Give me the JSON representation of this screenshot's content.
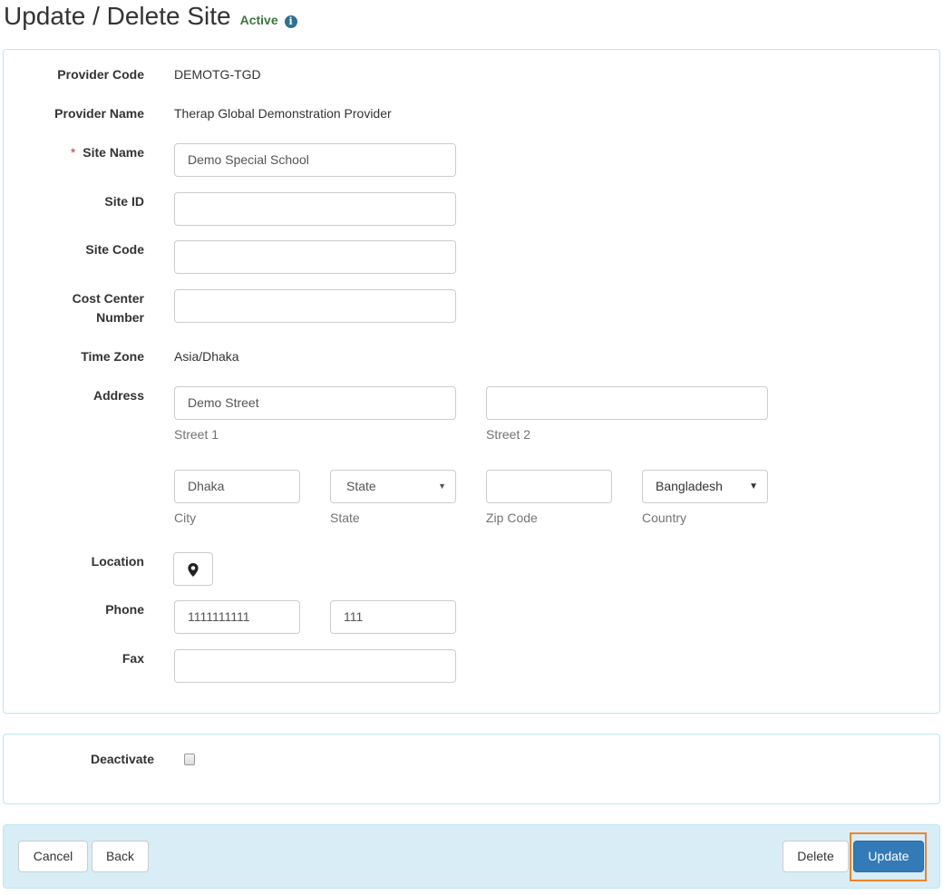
{
  "header": {
    "title": "Update / Delete Site",
    "status": "Active",
    "info_icon": "info-circle-icon"
  },
  "form": {
    "provider_code": {
      "label": "Provider Code",
      "value": "DEMOTG-TGD"
    },
    "provider_name": {
      "label": "Provider Name",
      "value": "Therap Global Demonstration Provider"
    },
    "site_name": {
      "label": "Site Name",
      "required_mark": "*",
      "value": "Demo Special School"
    },
    "site_id": {
      "label": "Site ID",
      "value": ""
    },
    "site_code": {
      "label": "Site Code",
      "value": ""
    },
    "cost_center": {
      "label_line1": "Cost Center",
      "label_line2": "Number",
      "value": ""
    },
    "time_zone": {
      "label": "Time Zone",
      "value": "Asia/Dhaka"
    },
    "address": {
      "label": "Address",
      "street1": {
        "value": "Demo Street",
        "help": "Street 1"
      },
      "street2": {
        "value": "",
        "help": "Street 2"
      },
      "city": {
        "value": "Dhaka",
        "help": "City"
      },
      "state": {
        "value": "State",
        "help": "State"
      },
      "zip": {
        "value": "",
        "help": "Zip Code"
      },
      "country": {
        "value": "Bangladesh",
        "help": "Country"
      }
    },
    "location": {
      "label": "Location",
      "icon": "map-marker-icon"
    },
    "phone": {
      "label": "Phone",
      "number": "1111111111",
      "ext": "111"
    },
    "fax": {
      "label": "Fax",
      "value": ""
    }
  },
  "deactivate": {
    "label": "Deactivate",
    "checked": false
  },
  "actions": {
    "cancel": "Cancel",
    "back": "Back",
    "delete": "Delete",
    "update": "Update"
  }
}
